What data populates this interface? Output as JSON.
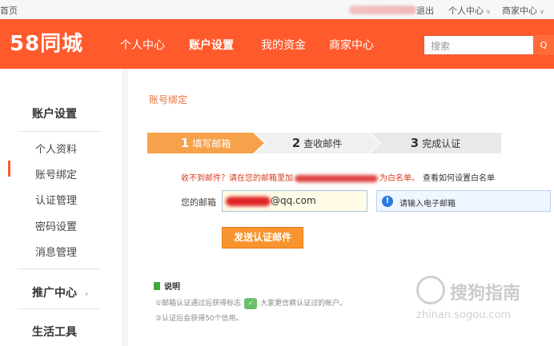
{
  "topbar": {
    "home": "首页",
    "logout": "退出",
    "personal_center": "个人中心",
    "merchant_center": "商家中心"
  },
  "header": {
    "logo": "58同城",
    "nav": [
      "个人中心",
      "账户设置",
      "我的资金",
      "商家中心"
    ],
    "active_nav": "账户设置",
    "search_placeholder": "搜索",
    "search_button": "Q"
  },
  "sidebar": {
    "account_settings_title": "账户设置",
    "items": [
      "个人资料",
      "账号绑定",
      "认证管理",
      "密码设置",
      "消息管理"
    ],
    "active_item": "账号绑定",
    "promo_title": "推广中心",
    "life_tools_title": "生活工具"
  },
  "main": {
    "section_title": "账号绑定",
    "steps": [
      {
        "num": "1",
        "label": "填写邮箱"
      },
      {
        "num": "2",
        "label": "查收邮件"
      },
      {
        "num": "3",
        "label": "完成认证"
      }
    ],
    "notice_prefix": "收不到邮件？请在您的邮箱里加",
    "notice_suffix": "为白名单。",
    "notice_help": "查看如何设置白名单",
    "email_label": "您的邮箱",
    "email_suffix": "@qq.com",
    "tip_text": "请输入电子邮箱",
    "send_button": "发送认证邮件",
    "notes_title": "说明",
    "note1_prefix": "①邮箱认证通过后获得标志",
    "note1_suffix": "大家更信赖认证过的帐户。",
    "note2": "②认证后会获得50个信用。"
  },
  "watermark": {
    "text": "搜狗指南",
    "url": "zhinan.sogou.com"
  },
  "colors": {
    "brand": "#ff5a2c",
    "step_active": "#f6a24a",
    "button": "#f7942e",
    "notice": "#d63b1f"
  }
}
